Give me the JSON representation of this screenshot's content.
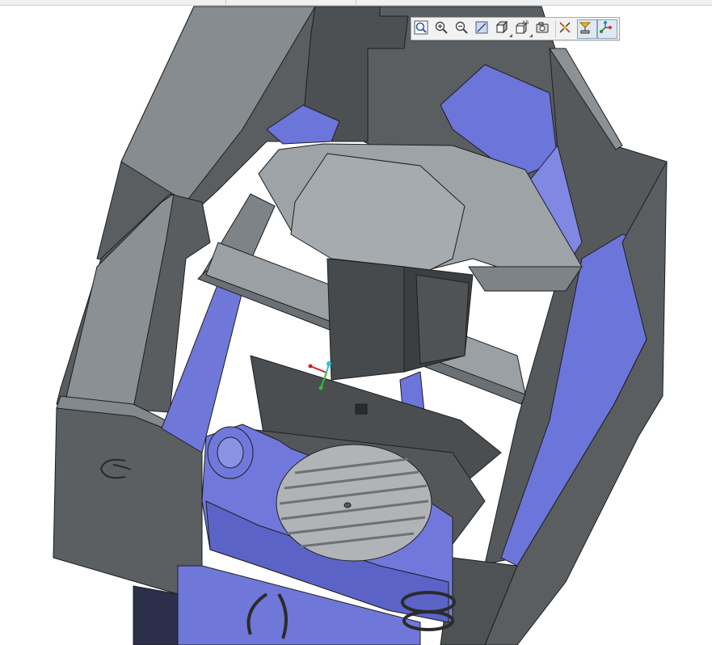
{
  "window": {
    "title": ""
  },
  "toolbar": {
    "items": [
      {
        "id": "refit",
        "icon": "zoom-fit-icon",
        "active": false
      },
      {
        "id": "zoom_in",
        "icon": "zoom-in-icon",
        "active": false
      },
      {
        "id": "zoom_out",
        "icon": "zoom-out-icon",
        "active": false
      },
      {
        "id": "repaint",
        "icon": "repaint-icon",
        "active": false
      },
      {
        "id": "display_style",
        "icon": "display-style-cube-icon",
        "active": false
      },
      {
        "id": "saved_views",
        "icon": "saved-views-icon",
        "active": false,
        "glyph_text": "AB"
      },
      {
        "id": "view_manager",
        "icon": "camera-icon",
        "active": false
      },
      {
        "id": "datum_display",
        "icon": "datum-display-icon",
        "active": false
      },
      {
        "id": "annotation_display",
        "icon": "annotation-display-icon",
        "active": true
      },
      {
        "id": "spin_center",
        "icon": "spin-center-icon",
        "active": true
      }
    ]
  },
  "model": {
    "description_icon": "cnc-machine-model",
    "colors": {
      "housing": "#5a5e61",
      "housing_light": "#8e9498",
      "housing_dark": "#3f4244",
      "accent_blue": "#6c75d9",
      "accent_blue_light": "#8e96e6",
      "table": "#b0b4b6",
      "table_slot": "#6d7174",
      "edge": "#1e1e1e"
    }
  },
  "coordinate_triad": {
    "x_color": "#d81e1e",
    "y_color": "#2fbf2f",
    "z_color": "#22c4d8"
  }
}
